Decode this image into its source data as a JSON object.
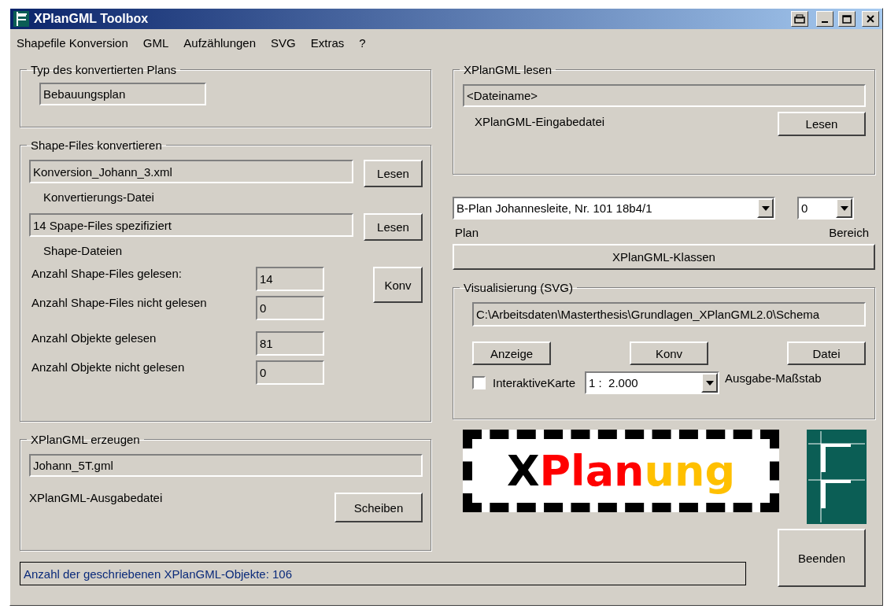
{
  "window": {
    "title": "XPlanGML Toolbox"
  },
  "menu": [
    "Shapefile Konversion",
    "GML",
    "Aufzählungen",
    "SVG",
    "Extras",
    "?"
  ],
  "plan_type": {
    "legend": "Typ des konvertierten Plans",
    "value": "Bebauungsplan"
  },
  "shape_conversion": {
    "legend": "Shape-Files konvertieren",
    "files": [
      {
        "value": "Konversion_Johann_3.xml",
        "button": "Lesen",
        "label": "Konvertierungs-Datei"
      },
      {
        "value": "14 Spape-Files spezifiziert",
        "button": "Lesen",
        "label": "Shape-Dateien"
      }
    ],
    "counts": [
      {
        "label": "Anzahl Shape-Files gelesen:",
        "value": "14"
      },
      {
        "label": "Anzahl Shape-Files nicht gelesen",
        "value": "0"
      },
      {
        "label": "Anzahl Objekte gelesen",
        "value": "81"
      },
      {
        "label": "Anzahl Objekte nicht gelesen",
        "value": "0"
      }
    ],
    "convert_button": "Konv"
  },
  "gml_output": {
    "legend": "XPlanGML erzeugen",
    "value": "Johann_5T.gml",
    "label": "XPlanGML-Ausgabedatei",
    "button": "Scheiben"
  },
  "status_bar": "Anzahl der geschriebenen XPlanGML-Objekte: 106",
  "gml_input": {
    "legend": "XPlanGML lesen",
    "value": "<Dateiname>",
    "label": "XPlanGML-Eingabedatei",
    "button": "Lesen"
  },
  "plan_select": {
    "value": "B-Plan Johannesleite, Nr. 101 18b4/1",
    "label": "Plan"
  },
  "area_select": {
    "value": "0",
    "label": "Bereich"
  },
  "classes_button": "XPlanGML-Klassen",
  "visualization": {
    "legend": "Visualisierung (SVG)",
    "path": "C:\\Arbeitsdaten\\Masterthesis\\Grundlagen_XPlanGML2.0\\Schema",
    "buttons": [
      "Anzeige",
      "Konv",
      "Datei"
    ],
    "interactive_map": {
      "label": "InteraktiveKarte",
      "checked": false
    },
    "scale": {
      "value": "1 :  2.000",
      "label": "Ausgabe-Maßstab"
    }
  },
  "logo": {
    "parts": [
      {
        "text": "X",
        "color": "#000000"
      },
      {
        "text": "Plan",
        "color": "#ff0000"
      },
      {
        "text": "ung",
        "color": "#ffc000"
      }
    ]
  },
  "quit_button": "Beenden"
}
